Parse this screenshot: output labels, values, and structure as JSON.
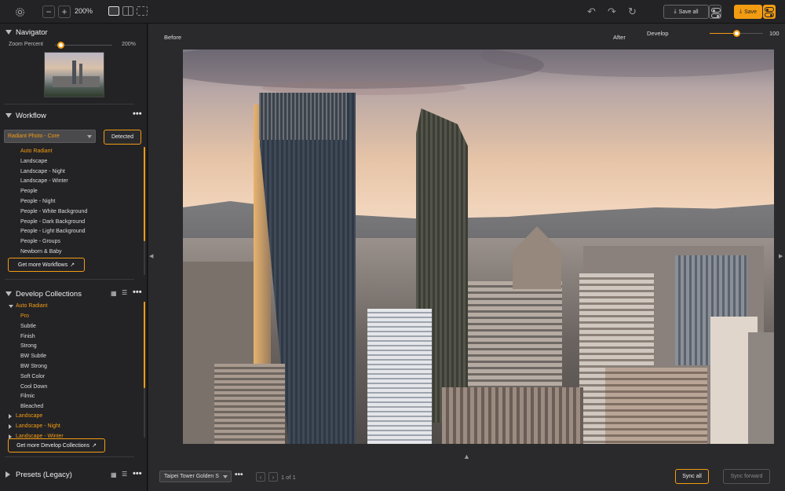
{
  "toolbar": {
    "zoom_value": "200%",
    "zoom_minus": "−",
    "zoom_plus": "+",
    "save_all_label": "Save all",
    "save_label": "Save"
  },
  "navigator": {
    "title": "Navigator",
    "zoom_label": "Zoom Percent",
    "zoom_value": "200%",
    "zoom_slider_fraction": 0.1
  },
  "workflow": {
    "title": "Workflow",
    "selected": "Radiant Photo - Core",
    "detected_label": "Detected",
    "items": [
      {
        "label": "Auto Radiant",
        "active": true
      },
      {
        "label": "Landscape"
      },
      {
        "label": "Landscape - Night"
      },
      {
        "label": "Landscape - Winter"
      },
      {
        "label": "People"
      },
      {
        "label": "People - Night"
      },
      {
        "label": "People - White Background"
      },
      {
        "label": "People - Dark Background"
      },
      {
        "label": "People - Light Background"
      },
      {
        "label": "People - Groups"
      },
      {
        "label": "Newborn & Baby"
      }
    ],
    "more_label": "Get more Workflows"
  },
  "develop_collections": {
    "title": "Develop Collections",
    "group": "Auto Radiant",
    "items": [
      {
        "label": "Pro",
        "active": true
      },
      {
        "label": "Subtle"
      },
      {
        "label": "Finish"
      },
      {
        "label": "Strong"
      },
      {
        "label": "BW Subtle"
      },
      {
        "label": "BW Strong"
      },
      {
        "label": "Soft Color"
      },
      {
        "label": "Cool Down"
      },
      {
        "label": "Filmic"
      },
      {
        "label": "Bleached"
      }
    ],
    "collapsed": [
      "Landscape",
      "Landscape - Night",
      "Landscape - Winter"
    ],
    "more_label": "Get more Develop Collections"
  },
  "presets": {
    "title": "Presets (Legacy)"
  },
  "canvas": {
    "before_label": "Before",
    "after_label": "After",
    "develop_label": "Develop",
    "develop_value": "100",
    "develop_fraction": 0.5
  },
  "bottom": {
    "image_name": "Taipei Tower Golden S",
    "page_text": "1 of 1",
    "sync_all_label": "Sync all",
    "sync_forward_label": "Sync forward"
  },
  "colors": {
    "accent": "#f39c12",
    "panel": "#232326",
    "workspace": "#2a2a2d"
  }
}
